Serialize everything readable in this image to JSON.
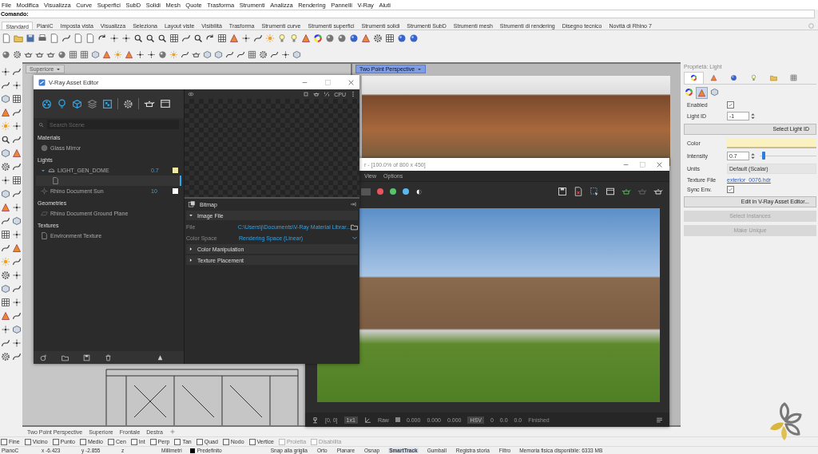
{
  "menu": [
    "File",
    "Modifica",
    "Visualizza",
    "Curve",
    "Superfici",
    "SubD",
    "Solidi",
    "Mesh",
    "Quote",
    "Trasforma",
    "Strumenti",
    "Analizza",
    "Rendering",
    "Pannelli",
    "V-Ray",
    "Aiuti"
  ],
  "command": {
    "label": "Comando:"
  },
  "toolbar_tabs": [
    {
      "label": "Standard",
      "selected": true
    },
    {
      "label": "PianiC",
      "selected": false
    },
    {
      "label": "Imposta vista",
      "selected": false
    },
    {
      "label": "Visualizza",
      "selected": false
    },
    {
      "label": "Seleziona",
      "selected": false
    },
    {
      "label": "Layout viste",
      "selected": false
    },
    {
      "label": "Visibilità",
      "selected": false
    },
    {
      "label": "Trasforma",
      "selected": false
    },
    {
      "label": "Strumenti curve",
      "selected": false
    },
    {
      "label": "Strumenti superfici",
      "selected": false
    },
    {
      "label": "Strumenti solidi",
      "selected": false
    },
    {
      "label": "Strumenti SubD",
      "selected": false
    },
    {
      "label": "Strumenti mesh",
      "selected": false
    },
    {
      "label": "Strumenti di rendering",
      "selected": false
    },
    {
      "label": "Disegno tecnico",
      "selected": false
    },
    {
      "label": "Novità di Rhino 7",
      "selected": false
    }
  ],
  "viewports": [
    {
      "title": "Superiore",
      "selected": false
    },
    {
      "title": "Two Point Perspective",
      "selected": true
    }
  ],
  "asset_editor": {
    "title": "V-Ray Asset Editor",
    "search": {
      "placeholder": "Search Scene"
    },
    "tree": [
      {
        "heading": "Materials",
        "items": [
          {
            "kind": "material",
            "name": "Glass Mirror",
            "selected": false
          }
        ]
      },
      {
        "heading": "Lights",
        "items": [
          {
            "kind": "dome",
            "name": "LIGHT_GEN_DOME",
            "intensity": "0.7",
            "color": "#f2eaa8",
            "expanded": true,
            "selected": false,
            "children": [
              {
                "kind": "texture",
                "selected": true
              }
            ]
          },
          {
            "kind": "sun",
            "name": "Rhino Document Sun",
            "intensity": "10",
            "color": "#ffffff",
            "selected": false
          }
        ]
      },
      {
        "heading": "Geometries",
        "items": [
          {
            "kind": "geometry",
            "name": "Rhino Document Ground Plane",
            "selected": false
          }
        ]
      },
      {
        "heading": "Textures",
        "items": [
          {
            "kind": "texture",
            "name": "Environment Texture",
            "selected": false
          }
        ]
      }
    ],
    "preview": {
      "engine": "CPU"
    },
    "bitmap": {
      "title": "Bitmap",
      "sections": [
        {
          "label": "Image File",
          "expanded": true,
          "params": [
            {
              "kind": "file",
              "label": "File",
              "value": "C:\\Users\\j\\Documents\\V-Ray Material Librar..."
            },
            {
              "kind": "dropdown",
              "label": "Color Space",
              "value": "Rendering Space (Linear)"
            }
          ]
        },
        {
          "label": "Color Manipulation",
          "expanded": false
        },
        {
          "label": "Texture Placement",
          "expanded": false
        }
      ]
    }
  },
  "frame_buffer": {
    "title": "r - [100.0% of 800 x 450]",
    "menu": [
      "View",
      "Options"
    ],
    "channels": [
      {
        "color": "#e8555a"
      },
      {
        "color": "#58c468"
      },
      {
        "color": "#5ab8ec"
      }
    ],
    "status": {
      "coords": "[0, 0]",
      "zoom": "1x1",
      "mode": "Raw",
      "values": [
        "0.000",
        "0.000",
        "0.000"
      ],
      "color_mode": "HSV",
      "hsv": [
        "0",
        "0.0",
        "0.0"
      ],
      "state": "Finished"
    }
  },
  "properties": {
    "title": "Proprietà: Light",
    "tabs": [
      {
        "selected": true
      },
      {
        "selected": false
      },
      {
        "selected": false
      },
      {
        "selected": false
      },
      {
        "selected": false
      },
      {
        "selected": false
      }
    ],
    "subtabs": [
      {
        "selected": false
      },
      {
        "selected": true
      },
      {
        "selected": false
      }
    ],
    "fields": [
      {
        "kind": "checkbox",
        "label": "Enabled",
        "checked": true
      },
      {
        "kind": "spinner",
        "label": "Light ID",
        "value": "-1"
      },
      {
        "kind": "button",
        "label": "Select Light ID",
        "disabled": false
      },
      {
        "kind": "color",
        "label": "Color",
        "color": "#fbf0c0"
      },
      {
        "kind": "slider",
        "label": "Intensity",
        "value": "0.7",
        "level": 0.07
      },
      {
        "kind": "dropdown",
        "label": "Units",
        "value": "Default (Scalar)"
      },
      {
        "kind": "link",
        "label": "Texture File",
        "value": "exterior_0076.hdr"
      },
      {
        "kind": "checkbox",
        "label": "Sync Env.",
        "checked": true
      },
      {
        "kind": "button",
        "label": "Edit in V-Ray Asset Editor...",
        "disabled": false
      },
      {
        "kind": "button",
        "label": "Select Instances",
        "disabled": true
      },
      {
        "kind": "button",
        "label": "Make Unique",
        "disabled": true
      }
    ]
  },
  "viewport_tabs": [
    "Two Point Perspective",
    "Superiore",
    "Frontale",
    "Destra"
  ],
  "osnaps": [
    {
      "label": "Fine",
      "checked": false,
      "disabled": false
    },
    {
      "label": "Vicino",
      "checked": false,
      "disabled": false
    },
    {
      "label": "Punto",
      "checked": false,
      "disabled": false
    },
    {
      "label": "Medio",
      "checked": false,
      "disabled": false
    },
    {
      "label": "Cen",
      "checked": false,
      "disabled": false
    },
    {
      "label": "Int",
      "checked": false,
      "disabled": false
    },
    {
      "label": "Perp",
      "checked": false,
      "disabled": false
    },
    {
      "label": "Tan",
      "checked": false,
      "disabled": false
    },
    {
      "label": "Quad",
      "checked": false,
      "disabled": false
    },
    {
      "label": "Nodo",
      "checked": false,
      "disabled": false
    },
    {
      "label": "Vertice",
      "checked": false,
      "disabled": false
    },
    {
      "label": "Proietta",
      "checked": false,
      "disabled": true
    },
    {
      "label": "Disabilita",
      "checked": false,
      "disabled": true
    }
  ],
  "status_bar": {
    "cplane": "PianoC",
    "x": "x -6.423",
    "y": "y -2.855",
    "z": "z",
    "units": "Millimetri",
    "layer": {
      "name": "Predefinito",
      "color": "#000000"
    },
    "toggles": [
      {
        "label": "Snap alla griglia",
        "on": false
      },
      {
        "label": "Orto",
        "on": false
      },
      {
        "label": "Planare",
        "on": false
      },
      {
        "label": "Osnap",
        "on": false
      },
      {
        "label": "SmartTrack",
        "on": true
      },
      {
        "label": "Gumball",
        "on": false
      },
      {
        "label": "Registra storia",
        "on": false
      },
      {
        "label": "Filtro",
        "on": false
      }
    ],
    "memory": "Memoria fisica disponibile: 6333 MB"
  }
}
